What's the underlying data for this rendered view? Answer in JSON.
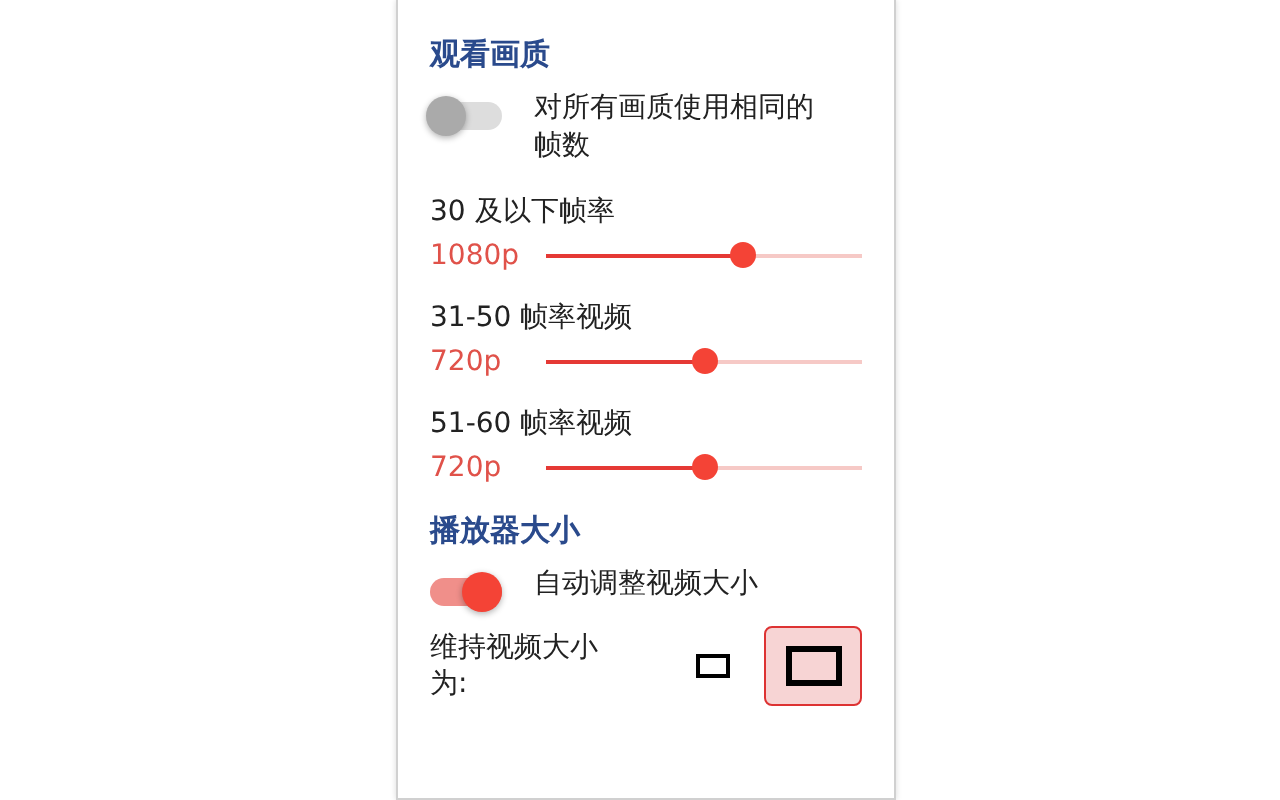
{
  "sections": [
    {
      "title": "观看画质",
      "toggle": {
        "label": "对所有画质使用相同的帧数",
        "on": false
      },
      "sliders": [
        {
          "label": "30 及以下帧率",
          "value": "1080p",
          "level": 0.62
        },
        {
          "label": "31-50 帧率视频",
          "value": "720p",
          "level": 0.5
        },
        {
          "label": "51-60 帧率视频",
          "value": "720p",
          "level": 0.5
        }
      ]
    },
    {
      "title": "播放器大小",
      "toggle": {
        "label": "自动调整视频大小",
        "on": true
      },
      "size_choice": {
        "label": "维持视频大小为:",
        "options": [
          {
            "kind": "small",
            "selected": false
          },
          {
            "kind": "large",
            "selected": true
          }
        ]
      }
    }
  ]
}
